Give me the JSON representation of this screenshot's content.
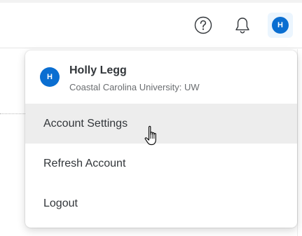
{
  "header": {
    "help_icon": "question-circle-icon",
    "bell_icon": "bell-icon",
    "avatar_initial": "H"
  },
  "user": {
    "initial": "H",
    "name": "Holly Legg",
    "org": "Coastal Carolina University: UW"
  },
  "menu": {
    "items": [
      {
        "label": "Account Settings",
        "state": "hovered"
      },
      {
        "label": "Refresh Account"
      },
      {
        "label": "Logout"
      }
    ]
  },
  "colors": {
    "accent": "#0a6ed1",
    "avatar_bg": "#ebf5fe",
    "hover_bg": "#ededed",
    "text": "#32363a",
    "subtext": "#6a6d70"
  },
  "cursor_icon": "hand-pointer-icon"
}
